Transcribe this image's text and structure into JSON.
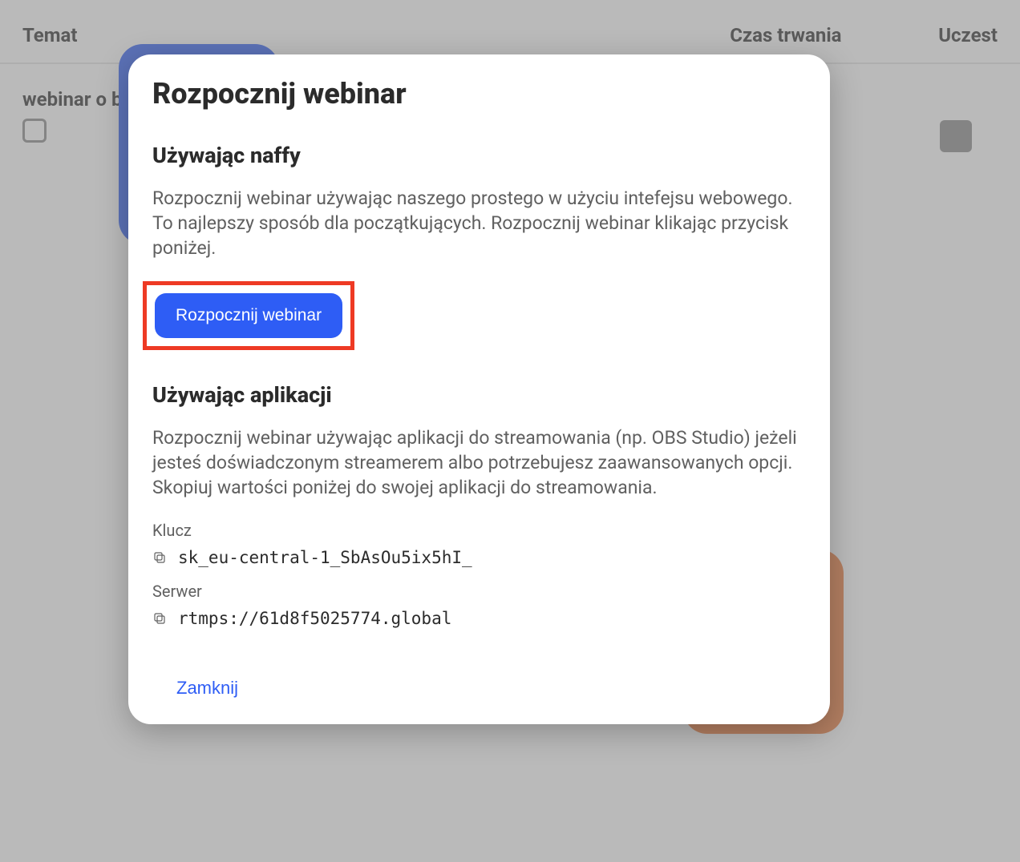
{
  "background": {
    "columns": {
      "topic": "Temat",
      "duration": "Czas trwania",
      "participants": "Uczest"
    },
    "row": {
      "title": "webinar o b"
    }
  },
  "modal": {
    "title": "Rozpocznij webinar",
    "section_naffy": {
      "heading": "Używając naffy",
      "description": "Rozpocznij webinar używając naszego prostego w użyciu intefejsu webowego. To najlepszy sposób dla początkujących. Rozpocznij webinar klikając przycisk poniżej.",
      "button": "Rozpocznij webinar"
    },
    "section_app": {
      "heading": "Używając aplikacji",
      "description": "Rozpocznij webinar używając aplikacji do streamowania (np. OBS Studio) jeżeli jesteś doświadczonym streamerem albo potrzebujesz zaawansowanych opcji. Skopiuj wartości poniżej do swojej aplikacji do streamowania.",
      "key_label": "Klucz",
      "key_value": "sk_eu-central-1_SbAsOu5ix5hI_",
      "server_label": "Serwer",
      "server_value": "rtmps://61d8f5025774.global"
    },
    "close": "Zamknij"
  }
}
